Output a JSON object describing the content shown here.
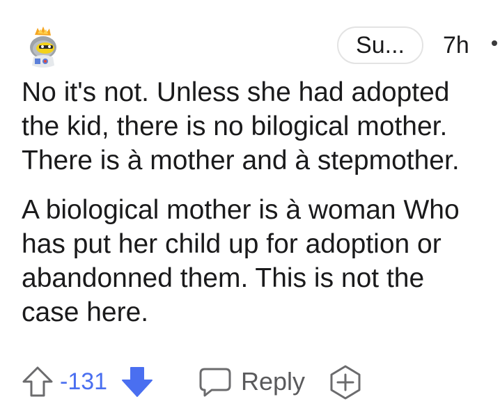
{
  "comment": {
    "avatar_icon": "snoo-avatar-icon",
    "user_flair": "Su...",
    "timestamp": "7h",
    "more_icon": "overflow-dot-icon",
    "paragraphs": [
      "No it's not. Unless she had adopted\nthe kid, there is no bilogical mother.\nThere is à mother and à stepmother.",
      "A biological mother is à woman Who\nhas put her child up for adoption or\nabandonned them. This is not the\ncase here."
    ]
  },
  "actions": {
    "upvote_icon": "arrow-up-outline-icon",
    "score": "-131",
    "downvote_icon": "arrow-down-filled-icon",
    "reply_icon": "speech-bubble-icon",
    "reply_label": "Reply",
    "award_icon": "plus-badge-icon",
    "downvote_color": "#4a6ff0",
    "score_color": "#4a6ff0"
  }
}
